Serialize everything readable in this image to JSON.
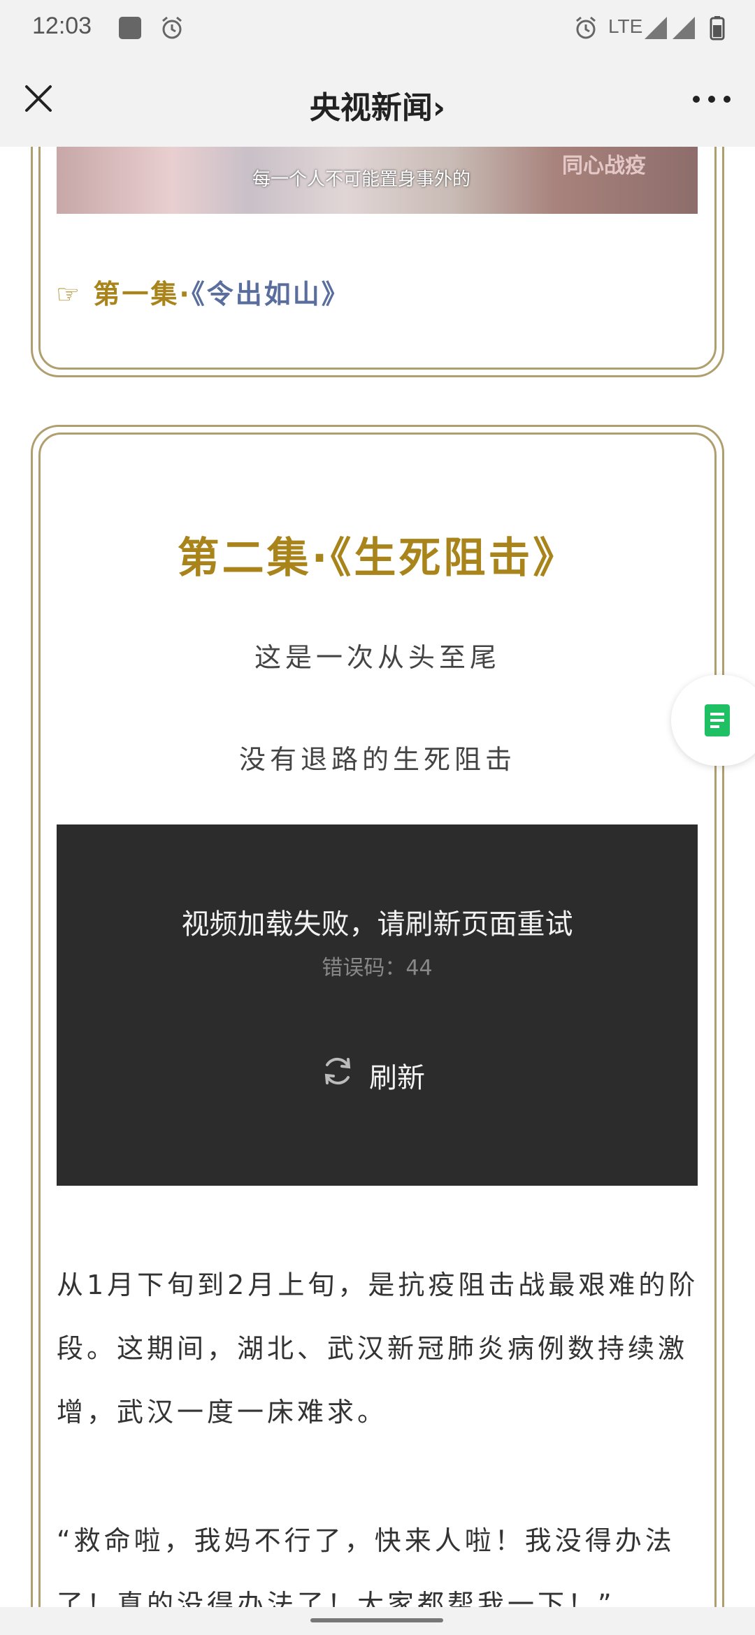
{
  "status_bar": {
    "time": "12:03",
    "network": "LTE"
  },
  "title_bar": {
    "title": "央视新闻",
    "chevron": "›"
  },
  "episode1": {
    "thumb_caption": "每一个人不可能置身事外的",
    "thumb_logo": "同心战疫",
    "hand": "☞",
    "number": "第一集·",
    "name": "《令出如山》"
  },
  "episode2": {
    "title": "第二集·《生死阻击》",
    "line1": "这是一次从头至尾",
    "line2": "没有退路的生死阻击"
  },
  "video": {
    "error_message": "视频加载失败，请刷新页面重试",
    "error_code": "错误码：44",
    "refresh_label": "刷新"
  },
  "paragraphs": {
    "p1": "从1月下旬到2月上旬，是抗疫阻击战最艰难的阶段。这期间，湖北、武汉新冠肺炎病例数持续激增，武汉一度一床难求。",
    "p2": "“救命啦，我妈不行了，快来人啦！我没得办法了！真的没得办法了！大家都帮我一下！”"
  },
  "colors": {
    "accent_gold": "#a8841a",
    "link_blue": "#5a6e9e",
    "frame": "#b09f6e",
    "float_green": "#1fbf63"
  }
}
